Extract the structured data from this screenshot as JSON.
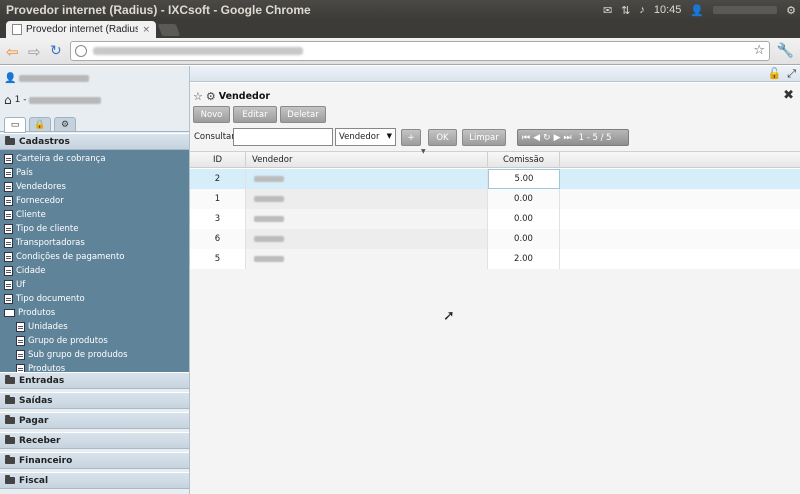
{
  "window": {
    "title": "Provedor internet (Radius) - IXCsoft - Google Chrome",
    "clock": "10:45"
  },
  "browser": {
    "tab_label": "Provedor internet (Radius) - IX",
    "tab_close": "×"
  },
  "sidebar": {
    "tabs": [
      "home",
      "lock",
      "gear"
    ],
    "sections": [
      {
        "label": "Cadastros"
      },
      {
        "label": "Entradas"
      },
      {
        "label": "Saídas"
      },
      {
        "label": "Pagar"
      },
      {
        "label": "Receber"
      },
      {
        "label": "Financeiro"
      },
      {
        "label": "Fiscal"
      }
    ],
    "cadastros_items": [
      "Carteira de cobrança",
      "País",
      "Vendedores",
      "Fornecedor",
      "Cliente",
      "Tipo de cliente",
      "Transportadoras",
      "Condições de pagamento",
      "Cidade",
      "Uf",
      "Tipo documento",
      "Produtos",
      "Unidades",
      "Grupo de produtos",
      "Sub grupo de produdos",
      "Produtos"
    ]
  },
  "panel": {
    "title": "Vendedor",
    "buttons": {
      "novo": "Novo",
      "editar": "Editar",
      "deletar": "Deletar"
    },
    "consult_label": "Consultar",
    "search_value": "",
    "filter_selected": "Vendedor",
    "plus_label": "+",
    "ok_label": "OK",
    "limpar_label": "Limpar",
    "pager_range": "1 - 5 / 5"
  },
  "grid": {
    "columns": [
      "ID",
      "Vendedor",
      "Comissão"
    ],
    "rows": [
      {
        "id": "2",
        "comissao": "5.00",
        "selected": true
      },
      {
        "id": "1",
        "comissao": "0.00"
      },
      {
        "id": "3",
        "comissao": "0.00"
      },
      {
        "id": "6",
        "comissao": "0.00"
      },
      {
        "id": "5",
        "comissao": "2.00"
      }
    ]
  },
  "colors": {
    "sidebar_tree_bg": "#5f8499",
    "selected_row": "#d5eefa",
    "button_grey": "#a8a8a8"
  }
}
